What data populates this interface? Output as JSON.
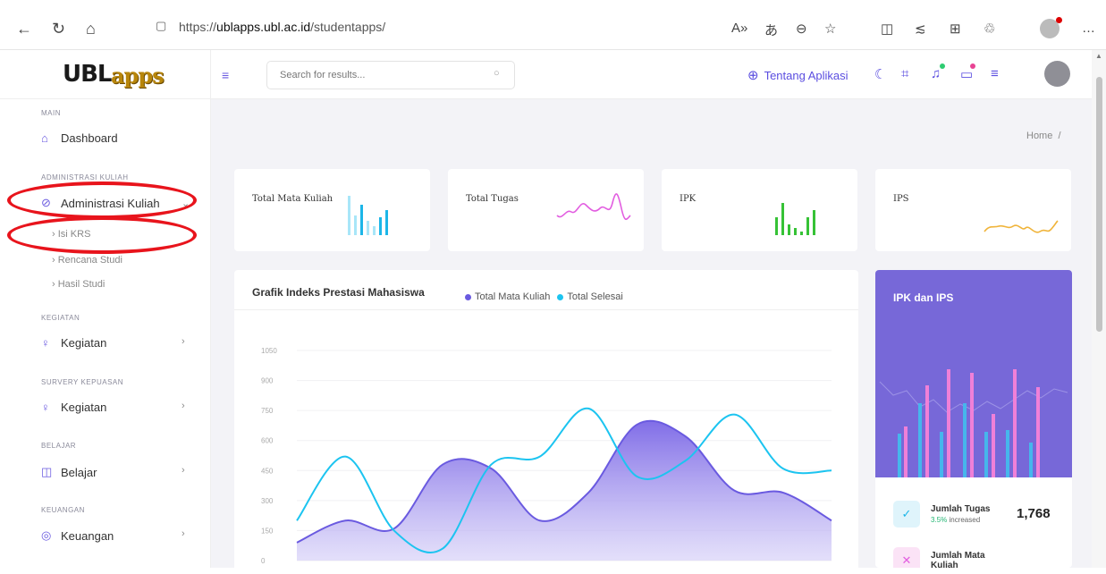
{
  "browser": {
    "url_prefix": "https://",
    "url_host": "ublapps.ubl.ac.id",
    "url_path": "/studentapps/"
  },
  "logo": {
    "ubl": "UBL",
    "apps": "apps"
  },
  "sidebar": {
    "cat_main": "MAIN",
    "dashboard": "Dashboard",
    "cat_admin": "ADMINISTRASI KULIAH",
    "admin_kuliah": "Administrasi Kuliah",
    "sub_isi_krs": "Isi KRS",
    "sub_rencana": "Rencana Studi",
    "sub_hasil": "Hasil Studi",
    "cat_kegiatan": "KEGIATAN",
    "kegiatan": "Kegiatan",
    "cat_survey": "SURVERY KEPUASAN",
    "kegiatan2": "Kegiatan",
    "cat_belajar": "BELAJAR",
    "belajar": "Belajar",
    "cat_keuangan": "KEUANGAN",
    "keuangan": "Keuangan"
  },
  "topbar": {
    "search_placeholder": "Search for results...",
    "about": "Tentang Aplikasi"
  },
  "breadcrumb": {
    "home": "Home",
    "sep": "/"
  },
  "stats": {
    "mata_kuliah": "Total Mata Kuliah",
    "tugas": "Total Tugas",
    "ipk": "IPK",
    "ips": "IPS"
  },
  "colors": {
    "accent": "#6a5ae0",
    "bar_series": "#5b6cf0",
    "line_series": "#1cc4f0",
    "annotation": "#e8141c"
  },
  "chart_panel": {
    "title": "Grafik Indeks Prestasi Mahasiswa",
    "legend_1": "Total Mata Kuliah",
    "legend_2": "Total Selesai"
  },
  "chart_data": {
    "type": "area",
    "title": "Grafik Indeks Prestasi Mahasiswa",
    "yticks": [
      "1050",
      "900",
      "750",
      "600",
      "450",
      "300",
      "150",
      "0"
    ],
    "ylim": [
      0,
      1050
    ],
    "series": [
      {
        "name": "Total Mata Kuliah",
        "values": [
          90,
          200,
          160,
          480,
          460,
          200,
          340,
          680,
          620,
          350,
          340,
          200
        ]
      },
      {
        "name": "Total Selesai",
        "values": [
          200,
          520,
          150,
          60,
          480,
          520,
          760,
          420,
          500,
          730,
          460,
          450
        ]
      }
    ]
  },
  "ipk_panel": {
    "title": "IPK dan IPS",
    "tugas_label": "Jumlah Tugas",
    "tugas_pct": "3.5%",
    "tugas_inc": "increased",
    "tugas_value": "1,768",
    "mk_label": "Jumlah Mata",
    "mk_label2": "Kuliah"
  }
}
